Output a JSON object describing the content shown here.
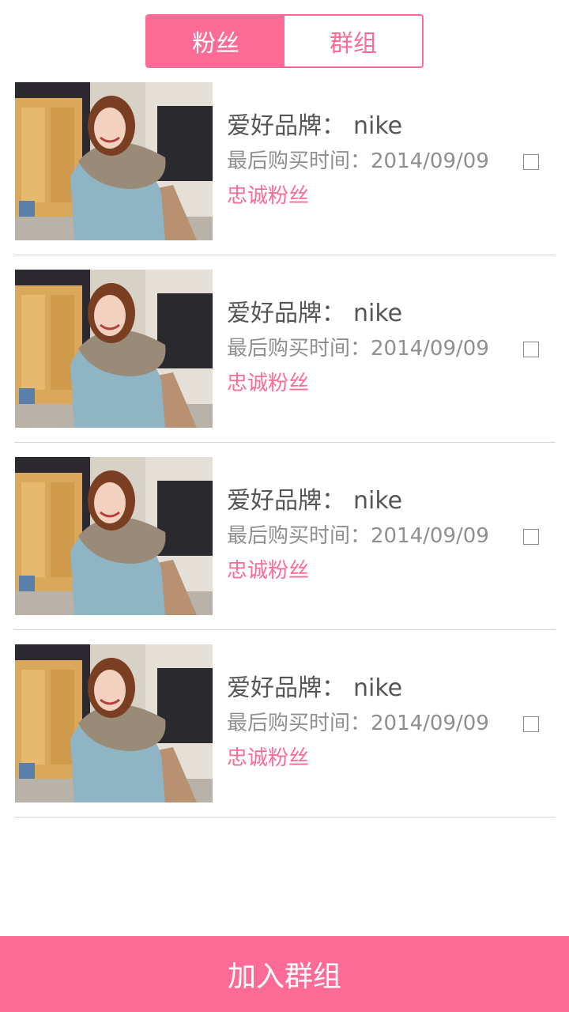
{
  "tabs": {
    "fans_label": "粉丝",
    "groups_label": "群组",
    "active": "fans"
  },
  "fans": [
    {
      "brand_label": "爱好品牌：",
      "brand_value": "nike",
      "last_purchase": "最后购买时间：2014/09/09",
      "tag": "忠诚粉丝",
      "checked": false
    },
    {
      "brand_label": "爱好品牌：",
      "brand_value": "nike",
      "last_purchase": "最后购买时间：2014/09/09",
      "tag": "忠诚粉丝",
      "checked": false
    },
    {
      "brand_label": "爱好品牌：",
      "brand_value": "nike",
      "last_purchase": "最后购买时间：2014/09/09",
      "tag": "忠诚粉丝",
      "checked": false
    },
    {
      "brand_label": "爱好品牌：",
      "brand_value": "nike",
      "last_purchase": "最后购买时间：2014/09/09",
      "tag": "忠诚粉丝",
      "checked": false
    }
  ],
  "footer": {
    "join_group_label": "加入群组"
  },
  "colors": {
    "accent": "#ff6b97",
    "text_primary": "#555555",
    "text_secondary": "#8f8f8f",
    "divider": "#d6d6d6"
  }
}
